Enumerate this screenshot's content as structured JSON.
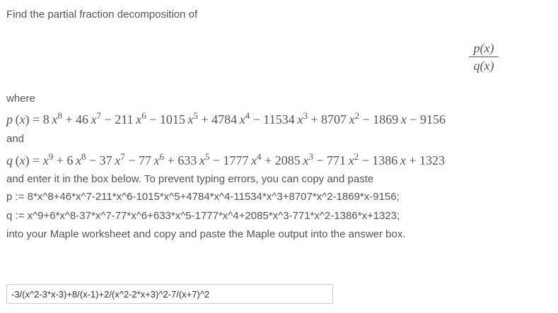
{
  "prompt": "Find the partial fraction decomposition of",
  "fraction": {
    "numerator": "p(x)",
    "denominator": "q(x)"
  },
  "where_label": "where",
  "and_label": "and",
  "p_expr": {
    "lhs": "p (x) = 8 x",
    "terms": [
      {
        "pre": "8",
        "pow": "8"
      },
      {
        "pre": "+ 46 x",
        "pow": "7"
      },
      {
        "pre": "− 211 x",
        "pow": "6"
      },
      {
        "pre": "− 1015 x",
        "pow": "5"
      },
      {
        "pre": "+ 4784 x",
        "pow": "4"
      },
      {
        "pre": "− 11534 x",
        "pow": "3"
      },
      {
        "pre": "+ 8707 x",
        "pow": "2"
      }
    ],
    "tail": "− 1869 x − 9156"
  },
  "q_expr": {
    "lhs": "q (x) = x",
    "terms": [
      {
        "pre": "x",
        "pow": "9"
      },
      {
        "pre": "+ 6 x",
        "pow": "8"
      },
      {
        "pre": "− 37 x",
        "pow": "7"
      },
      {
        "pre": "− 77 x",
        "pow": "6"
      },
      {
        "pre": "+ 633 x",
        "pow": "5"
      },
      {
        "pre": "− 1777 x",
        "pow": "4"
      },
      {
        "pre": "+ 2085 x",
        "pow": "3"
      },
      {
        "pre": "− 771 x",
        "pow": "2"
      }
    ],
    "tail": "− 1386 x + 1323"
  },
  "instruction": "and enter it in the box below.  To prevent typing errors, you can copy and paste",
  "p_code": "p := 8*x^8+46*x^7-211*x^6-1015*x^5+4784*x^4-11534*x^3+8707*x^2-1869*x-9156;",
  "q_code": "q := x^9+6*x^8-37*x^7-77*x^6+633*x^5-1777*x^4+2085*x^3-771*x^2-1386*x+1323;",
  "instruction2": "into your Maple worksheet and copy and paste the Maple output into the answer box.",
  "answer": {
    "value": "-3/(x^2-3*x-3)+8/(x-1)+2/(x^2-2*x+3)^2-7/(x+7)^2"
  }
}
